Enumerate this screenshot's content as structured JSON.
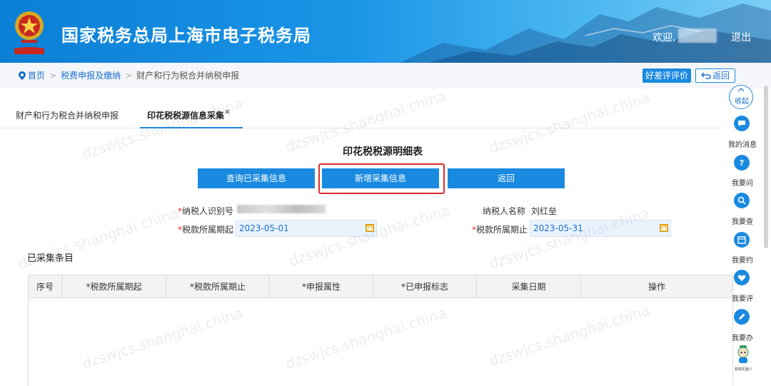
{
  "header": {
    "site_title": "国家税务总局上海市电子税务局",
    "welcome": "欢迎,",
    "logout": "退出",
    "emblem_text": "中国税务"
  },
  "breadcrumb": {
    "home": "首页",
    "level1": "税费申报及缴纳",
    "level2": "财产和行为税合并纳税申报",
    "separator": ">"
  },
  "toolbar": {
    "evaluate": "好差评评价",
    "back": "返回"
  },
  "tabs": [
    {
      "label": "财产和行为税合并纳税申报"
    },
    {
      "label": "印花税税源信息采集",
      "close": "×"
    }
  ],
  "main": {
    "title": "印花税税源明细表",
    "buttons": {
      "query": "查询已采集信息",
      "add": "新增采集信息",
      "return": "返回"
    },
    "form": {
      "taxpayer_id_label": "纳税人识别号",
      "taxpayer_name_label": "纳税人名称",
      "taxpayer_name": "刘红垒",
      "period_start_label": "税款所属期起",
      "period_start": "2023-05-01",
      "period_end_label": "税款所属期止",
      "period_end": "2023-05-31",
      "required_mark": "*"
    },
    "section_title": "已采集条目",
    "table": {
      "columns": [
        "序号",
        "*税款所属期起",
        "*税款所属期止",
        "*申报属性",
        "*已申报标志",
        "采集日期",
        "操作"
      ]
    }
  },
  "sidebar": {
    "collapse": "收起",
    "items": [
      {
        "label": "我的消息",
        "icon": "message-icon"
      },
      {
        "label": "我要问",
        "icon": "question-icon"
      },
      {
        "label": "我要查",
        "icon": "search-icon"
      },
      {
        "label": "我要约",
        "icon": "calendar-icon"
      },
      {
        "label": "我要评",
        "icon": "heart-icon"
      },
      {
        "label": "我要办",
        "icon": "pen-icon"
      }
    ],
    "robot_label": "税税机器人"
  },
  "watermark": "dzswjcs.shanghai.china",
  "colors": {
    "primary": "#1a8ae0",
    "highlight": "#e02a2a"
  }
}
